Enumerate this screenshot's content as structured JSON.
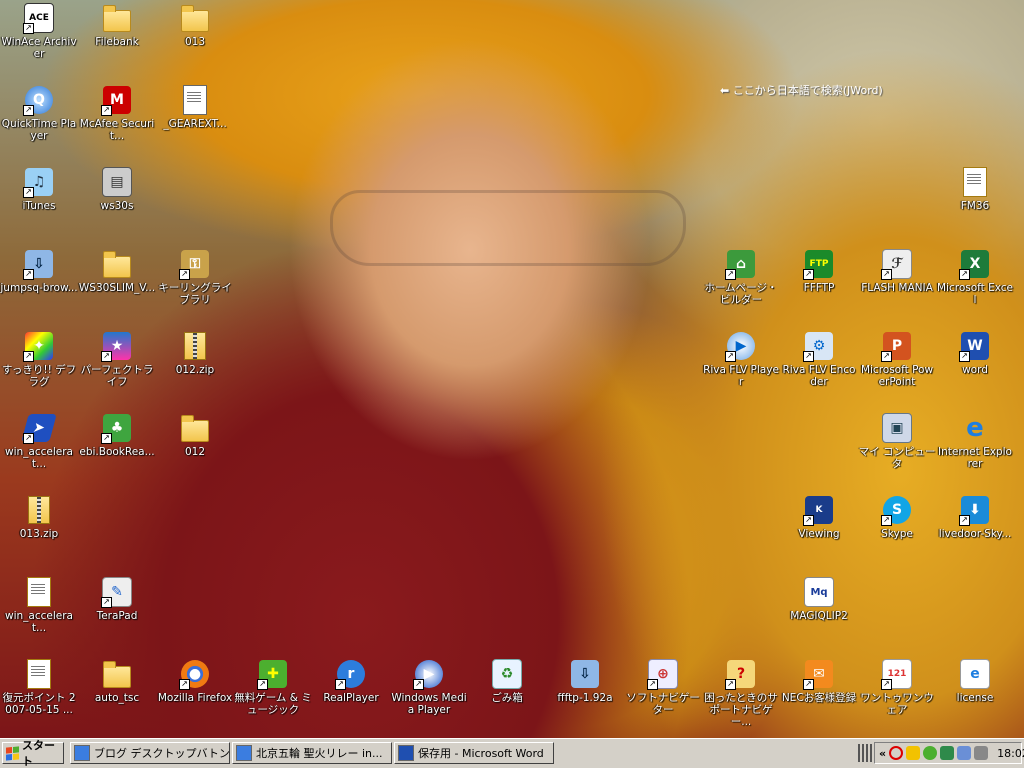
{
  "desktop": {
    "search_hint": "⬅ ここから日本語で検索(JWord)",
    "icons": [
      {
        "label": "WinAce Archiver",
        "icon": "winace-icon",
        "shortcut": true
      },
      {
        "label": "Filebank",
        "icon": "folder-icon",
        "shortcut": false
      },
      {
        "label": "013",
        "icon": "folder-icon",
        "shortcut": false
      },
      {
        "label": "QuickTime Player",
        "icon": "quicktime-icon",
        "shortcut": true
      },
      {
        "label": "McAfee Securit...",
        "icon": "mcafee-icon",
        "shortcut": true
      },
      {
        "label": "_GEAREXT...",
        "icon": "text-file-icon",
        "shortcut": false
      },
      {
        "label": "iTunes",
        "icon": "itunes-icon",
        "shortcut": true
      },
      {
        "label": "ws30s",
        "icon": "ws30s-app-icon",
        "shortcut": false
      },
      {
        "label": "jumpsq-brow...",
        "icon": "installer-icon",
        "shortcut": true
      },
      {
        "label": "WS30SLIM_V...",
        "icon": "folder-icon",
        "shortcut": false
      },
      {
        "label": "キーリングライブラリ",
        "icon": "keyring-icon",
        "shortcut": true
      },
      {
        "label": "すっきり!! デフラグ",
        "icon": "defrag-icon",
        "shortcut": true
      },
      {
        "label": "パーフェクトライフ",
        "icon": "perfect-life-icon",
        "shortcut": true
      },
      {
        "label": "012.zip",
        "icon": "zip-icon",
        "shortcut": false
      },
      {
        "label": "win_accelerat...",
        "icon": "accelerator-icon",
        "shortcut": true
      },
      {
        "label": "ebi.BookRea...",
        "icon": "book-reader-icon",
        "shortcut": true
      },
      {
        "label": "012",
        "icon": "folder-icon",
        "shortcut": false
      },
      {
        "label": "013.zip",
        "icon": "zip-icon",
        "shortcut": false
      },
      {
        "label": "win_accelerat...",
        "icon": "setup-file-icon",
        "shortcut": false
      },
      {
        "label": "TeraPad",
        "icon": "terapad-icon",
        "shortcut": true
      },
      {
        "label": "復元ポイント 2007-05-15 ...",
        "icon": "setup-file-icon",
        "shortcut": false
      },
      {
        "label": "auto_tsc",
        "icon": "folder-icon",
        "shortcut": false
      },
      {
        "label": "Mozilla Firefox",
        "icon": "firefox-icon",
        "shortcut": true
      },
      {
        "label": "無料ゲーム & ミュージック",
        "icon": "gift-icon",
        "shortcut": true
      },
      {
        "label": "RealPlayer",
        "icon": "realplayer-icon",
        "shortcut": true
      },
      {
        "label": "Windows Media Player",
        "icon": "media-player-icon",
        "shortcut": true
      },
      {
        "label": "ごみ箱",
        "icon": "recycle-bin-icon",
        "shortcut": false
      },
      {
        "label": "ffftp-1.92a",
        "icon": "installer-icon",
        "shortcut": false
      },
      {
        "label": "ソフトナビゲーター",
        "icon": "software-navi-icon",
        "shortcut": true
      },
      {
        "label": "困ったときのサポートナビゲー...",
        "icon": "support-navi-icon",
        "shortcut": true
      },
      {
        "label": "NECお客様登録",
        "icon": "nec-registration-icon",
        "shortcut": true
      },
      {
        "label": "ワントゥワンウェア",
        "icon": "one-to-one-ware-icon",
        "shortcut": true
      },
      {
        "label": "license",
        "icon": "ie-document-icon",
        "shortcut": false
      },
      {
        "label": "FM36",
        "icon": "setup-file-icon",
        "shortcut": false
      },
      {
        "label": "ホームページ・ビルダー",
        "icon": "homepage-builder-icon",
        "shortcut": true
      },
      {
        "label": "FFFTP",
        "icon": "ffftp-icon",
        "shortcut": true
      },
      {
        "label": "FLASH MANIA",
        "icon": "flash-mania-icon",
        "shortcut": true
      },
      {
        "label": "Microsoft Excel",
        "icon": "excel-icon",
        "shortcut": true
      },
      {
        "label": "Riva FLV Player",
        "icon": "riva-player-icon",
        "shortcut": true
      },
      {
        "label": "Riva FLV Encoder",
        "icon": "riva-encoder-icon",
        "shortcut": true
      },
      {
        "label": "Microsoft PowerPoint",
        "icon": "powerpoint-icon",
        "shortcut": true
      },
      {
        "label": "word",
        "icon": "word-icon",
        "shortcut": true
      },
      {
        "label": "マイ コンピュータ",
        "icon": "my-computer-icon",
        "shortcut": false
      },
      {
        "label": "Internet Explorer",
        "icon": "internet-explorer-icon",
        "shortcut": false
      },
      {
        "label": "Viewing",
        "icon": "viewing-icon",
        "shortcut": true
      },
      {
        "label": "Skype",
        "icon": "skype-icon",
        "shortcut": true
      },
      {
        "label": "livedoor-Sky...",
        "icon": "livedoor-skype-icon",
        "shortcut": true
      },
      {
        "label": "MAGIQLIP2",
        "icon": "magiqlip-icon",
        "shortcut": false
      }
    ]
  },
  "taskbar": {
    "start_label": "スタート",
    "tasks": [
      {
        "label": "ブログ デスクトップバトン ..."
      },
      {
        "label": "北京五輪 聖火リレー in..."
      },
      {
        "label": "保存用 - Microsoft Word"
      }
    ],
    "tray_chevron": "«",
    "clock": "18:02"
  },
  "colors": {
    "taskbar_bg": "#d4d0c8",
    "label_text": "#ffffff",
    "start_logo": [
      "#e8461f",
      "#4fae2f",
      "#2a6fe0",
      "#f6c516"
    ]
  }
}
